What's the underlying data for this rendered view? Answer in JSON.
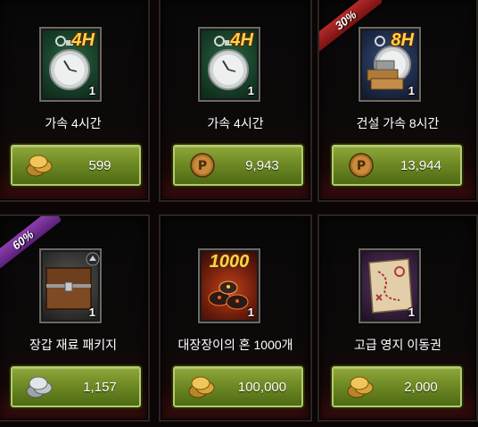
{
  "items": [
    {
      "name": "가속 4시간",
      "quantity": "1",
      "badge_text": "4H",
      "price": "599",
      "currency": "gold-coins-icon",
      "discount": ""
    },
    {
      "name": "가속 4시간",
      "quantity": "1",
      "badge_text": "4H",
      "price": "9,943",
      "currency": "p-coin-icon",
      "discount": ""
    },
    {
      "name": "건설 가속 8시간",
      "quantity": "1",
      "badge_text": "8H",
      "price": "13,944",
      "currency": "p-coin-icon",
      "discount": "30%"
    },
    {
      "name": "장갑 재료 패키지",
      "quantity": "1",
      "badge_text": "",
      "price": "1,157",
      "currency": "silver-coins-icon",
      "discount": "60%"
    },
    {
      "name": "대장장이의 혼 1000개",
      "quantity": "1",
      "badge_text": "1000",
      "price": "100,000",
      "currency": "gold-coins-icon",
      "discount": ""
    },
    {
      "name": "고급 영지 이동권",
      "quantity": "1",
      "badge_text": "",
      "price": "2,000",
      "currency": "gold-coins-icon",
      "discount": ""
    }
  ],
  "colors": {
    "button_green": "#6f8a24",
    "ribbon_red": "#b52a2a",
    "ribbon_purple": "#8c3fae",
    "badge_gold": "#ffd24a"
  }
}
